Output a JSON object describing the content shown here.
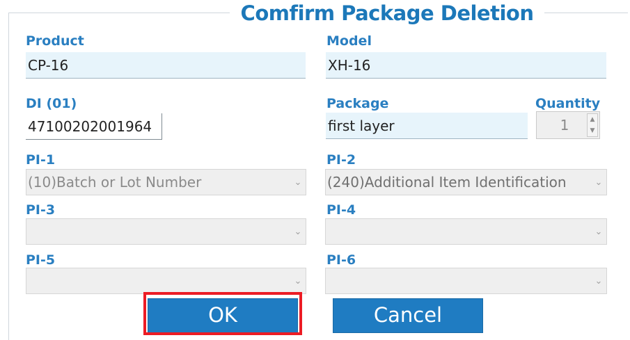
{
  "dialog": {
    "title": "Comfirm Package Deletion"
  },
  "product": {
    "label": "Product",
    "value": "CP-16"
  },
  "model": {
    "label": "Model",
    "value": "XH-16"
  },
  "di": {
    "label": "DI (01)",
    "value": "47100202001964"
  },
  "package": {
    "label": "Package",
    "value": "first layer"
  },
  "quantity": {
    "label": "Quantity",
    "value": "1"
  },
  "pi1": {
    "label": "PI-1",
    "value": "(10)Batch or Lot Number"
  },
  "pi2": {
    "label": "PI-2",
    "value": "(240)Additional Item Identification"
  },
  "pi3": {
    "label": "PI-3",
    "value": ""
  },
  "pi4": {
    "label": "PI-4",
    "value": ""
  },
  "pi5": {
    "label": "PI-5",
    "value": ""
  },
  "pi6": {
    "label": "PI-6",
    "value": ""
  },
  "buttons": {
    "ok": "OK",
    "cancel": "Cancel"
  },
  "icons": {
    "dropdown": "chevron-down-icon",
    "stepper_up": "caret-up-icon",
    "stepper_down": "caret-down-icon"
  },
  "colors": {
    "accent": "#1f7cc2",
    "label": "#2a7fc1",
    "highlight": "#ec1c24",
    "field_bg": "#e7f4fb"
  }
}
